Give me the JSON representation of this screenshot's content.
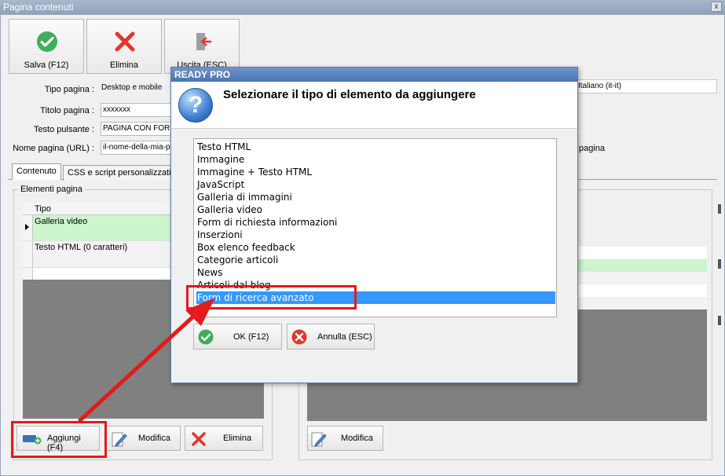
{
  "window": {
    "title": "Pagina contenuti",
    "close_glyph": "x"
  },
  "toolbar": {
    "save_label": "Salva (F12)",
    "delete_label": "Elimina",
    "exit_label": "Uscita (ESC)"
  },
  "form": {
    "tipo_label": "Tipo pagina :",
    "tipo_value": "Desktop e mobile",
    "titolo_label": "Titolo pagina :",
    "titolo_value": "xxxxxxx",
    "testo_label": "Testo pulsante :",
    "testo_value": "PAGINA CON FORM",
    "nome_label": "Nome pagina (URL) :",
    "nome_value": "il-nome-della-mia-pagina",
    "lang_value": "Italiano (it-it)",
    "right_fragment": "pagina"
  },
  "tabs": [
    {
      "label": "Contenuto"
    },
    {
      "label": "CSS e script personalizzati"
    }
  ],
  "elements": {
    "group_label": "Elementi pagina",
    "column_tipo": "Tipo",
    "rows": [
      "Galleria video",
      "Testo HTML (0 caratteri)"
    ]
  },
  "bottom": {
    "add_label": "Aggiungi (F4)",
    "edit_label": "Modifica",
    "delete_label": "Elimina",
    "edit2_label": "Modifica"
  },
  "dialog": {
    "title": "READY PRO",
    "question": "Selezionare il tipo di elemento da aggiungere",
    "question_glyph": "?",
    "items": [
      "Testo HTML",
      "Immagine",
      "Immagine + Testo HTML",
      "JavaScript",
      "Galleria di immagini",
      "Galleria video",
      "Form di richiesta informazioni",
      "Inserzioni",
      "Box elenco feedback",
      "Categorie articoli",
      "News",
      "Articoli dal blog",
      "Form di ricerca avanzato"
    ],
    "selected_index": 12,
    "ok_label": "OK (F12)",
    "cancel_label": "Annulla (ESC)"
  },
  "colors": {
    "accent_green": "#3fae5a",
    "accent_red": "#e0382b",
    "selection_blue": "#3399ff",
    "highlight_red": "#e21b1b",
    "row_green": "#ccf5cc"
  }
}
